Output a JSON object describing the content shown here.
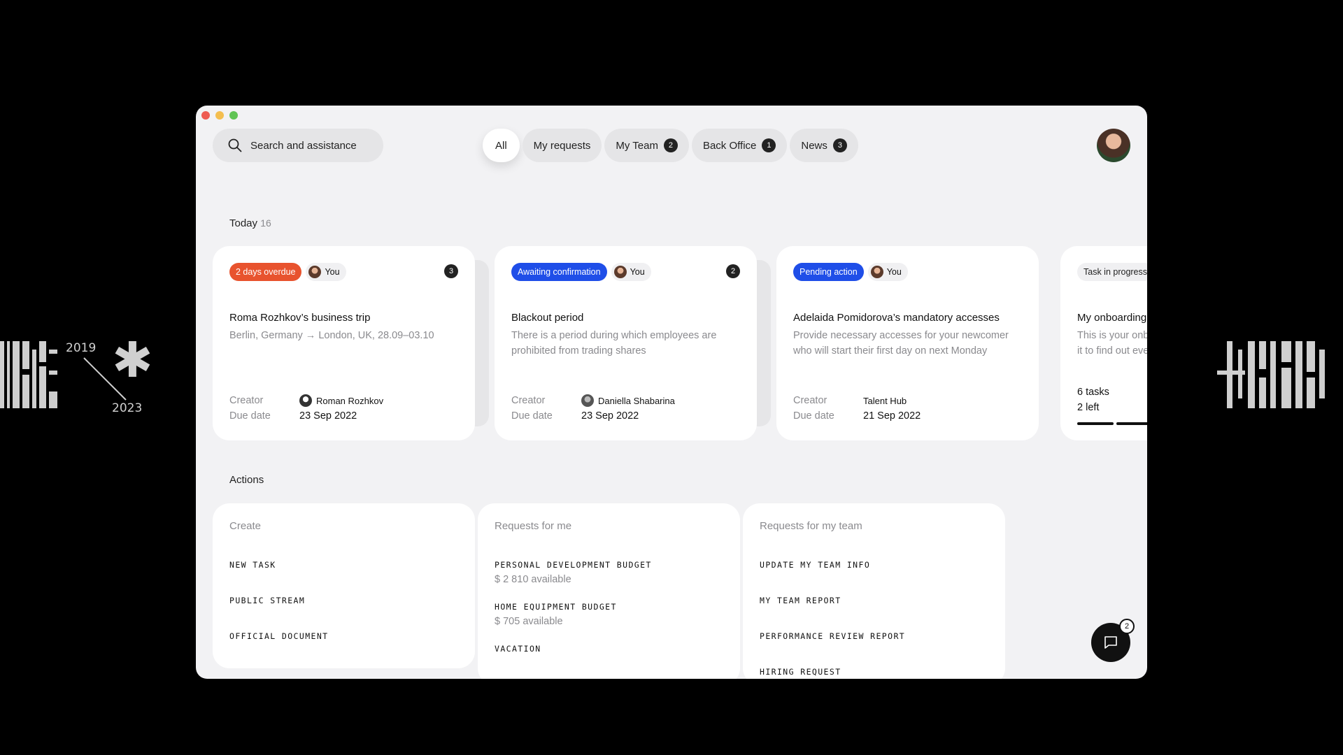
{
  "search": {
    "placeholder": "Search and assistance"
  },
  "tabs": [
    {
      "label": "All",
      "count": null
    },
    {
      "label": "My requests",
      "count": null
    },
    {
      "label": "My Team",
      "count": "2"
    },
    {
      "label": "Back Office",
      "count": "1"
    },
    {
      "label": "News",
      "count": "3"
    }
  ],
  "decor": {
    "year_start": "2019",
    "year_end": "2023"
  },
  "today": {
    "label": "Today",
    "count": "16"
  },
  "cards": [
    {
      "status": "2 days overdue",
      "assignee": "You",
      "count": "3",
      "title": "Roma Rozhkov’s business trip",
      "description": "Berlin, Germany → London, UK, 28.09–03.10",
      "creator_label": "Creator",
      "creator": "Roman Rozhkov",
      "due_label": "Due date",
      "due": "23 Sep 2022"
    },
    {
      "status": "Awaiting confirmation",
      "assignee": "You",
      "count": "2",
      "title": "Blackout period",
      "description": "There is a period during which employees are prohibited from trading shares",
      "creator_label": "Creator",
      "creator": "Daniella Shabarina",
      "due_label": "Due date",
      "due": "23 Sep 2022"
    },
    {
      "status": "Pending action",
      "assignee": "You",
      "title": "Adelaida Pomidorova’s mandatory accesses",
      "description": "Provide necessary accesses for your newcomer who will start their first day on next Monday",
      "creator_label": "Creator",
      "creator": "Talent Hub",
      "due_label": "Due date",
      "due": "21 Sep 2022"
    },
    {
      "status": "Task in progress",
      "title": "My onboarding",
      "description": "This is your onboard it to find out everyth",
      "tasks": "6 tasks",
      "left": "2 left"
    }
  ],
  "actions": {
    "label": "Actions",
    "create": {
      "title": "Create",
      "items": [
        "NEW TASK",
        "PUBLIC STREAM",
        "OFFICIAL DOCUMENT"
      ]
    },
    "for_me": {
      "title": "Requests for me",
      "items": [
        {
          "label": "PERSONAL DEVELOPMENT BUDGET",
          "sub": "$ 2 810 available"
        },
        {
          "label": "HOME EQUIPMENT BUDGET",
          "sub": "$ 705 available"
        },
        {
          "label": "VACATION",
          "sub": ""
        }
      ]
    },
    "for_team": {
      "title": "Requests for my team",
      "items": [
        "UPDATE MY TEAM INFO",
        "MY TEAM REPORT",
        "PERFORMANCE REVIEW REPORT",
        "HIRING REQUEST"
      ]
    }
  },
  "chat": {
    "count": "2"
  }
}
